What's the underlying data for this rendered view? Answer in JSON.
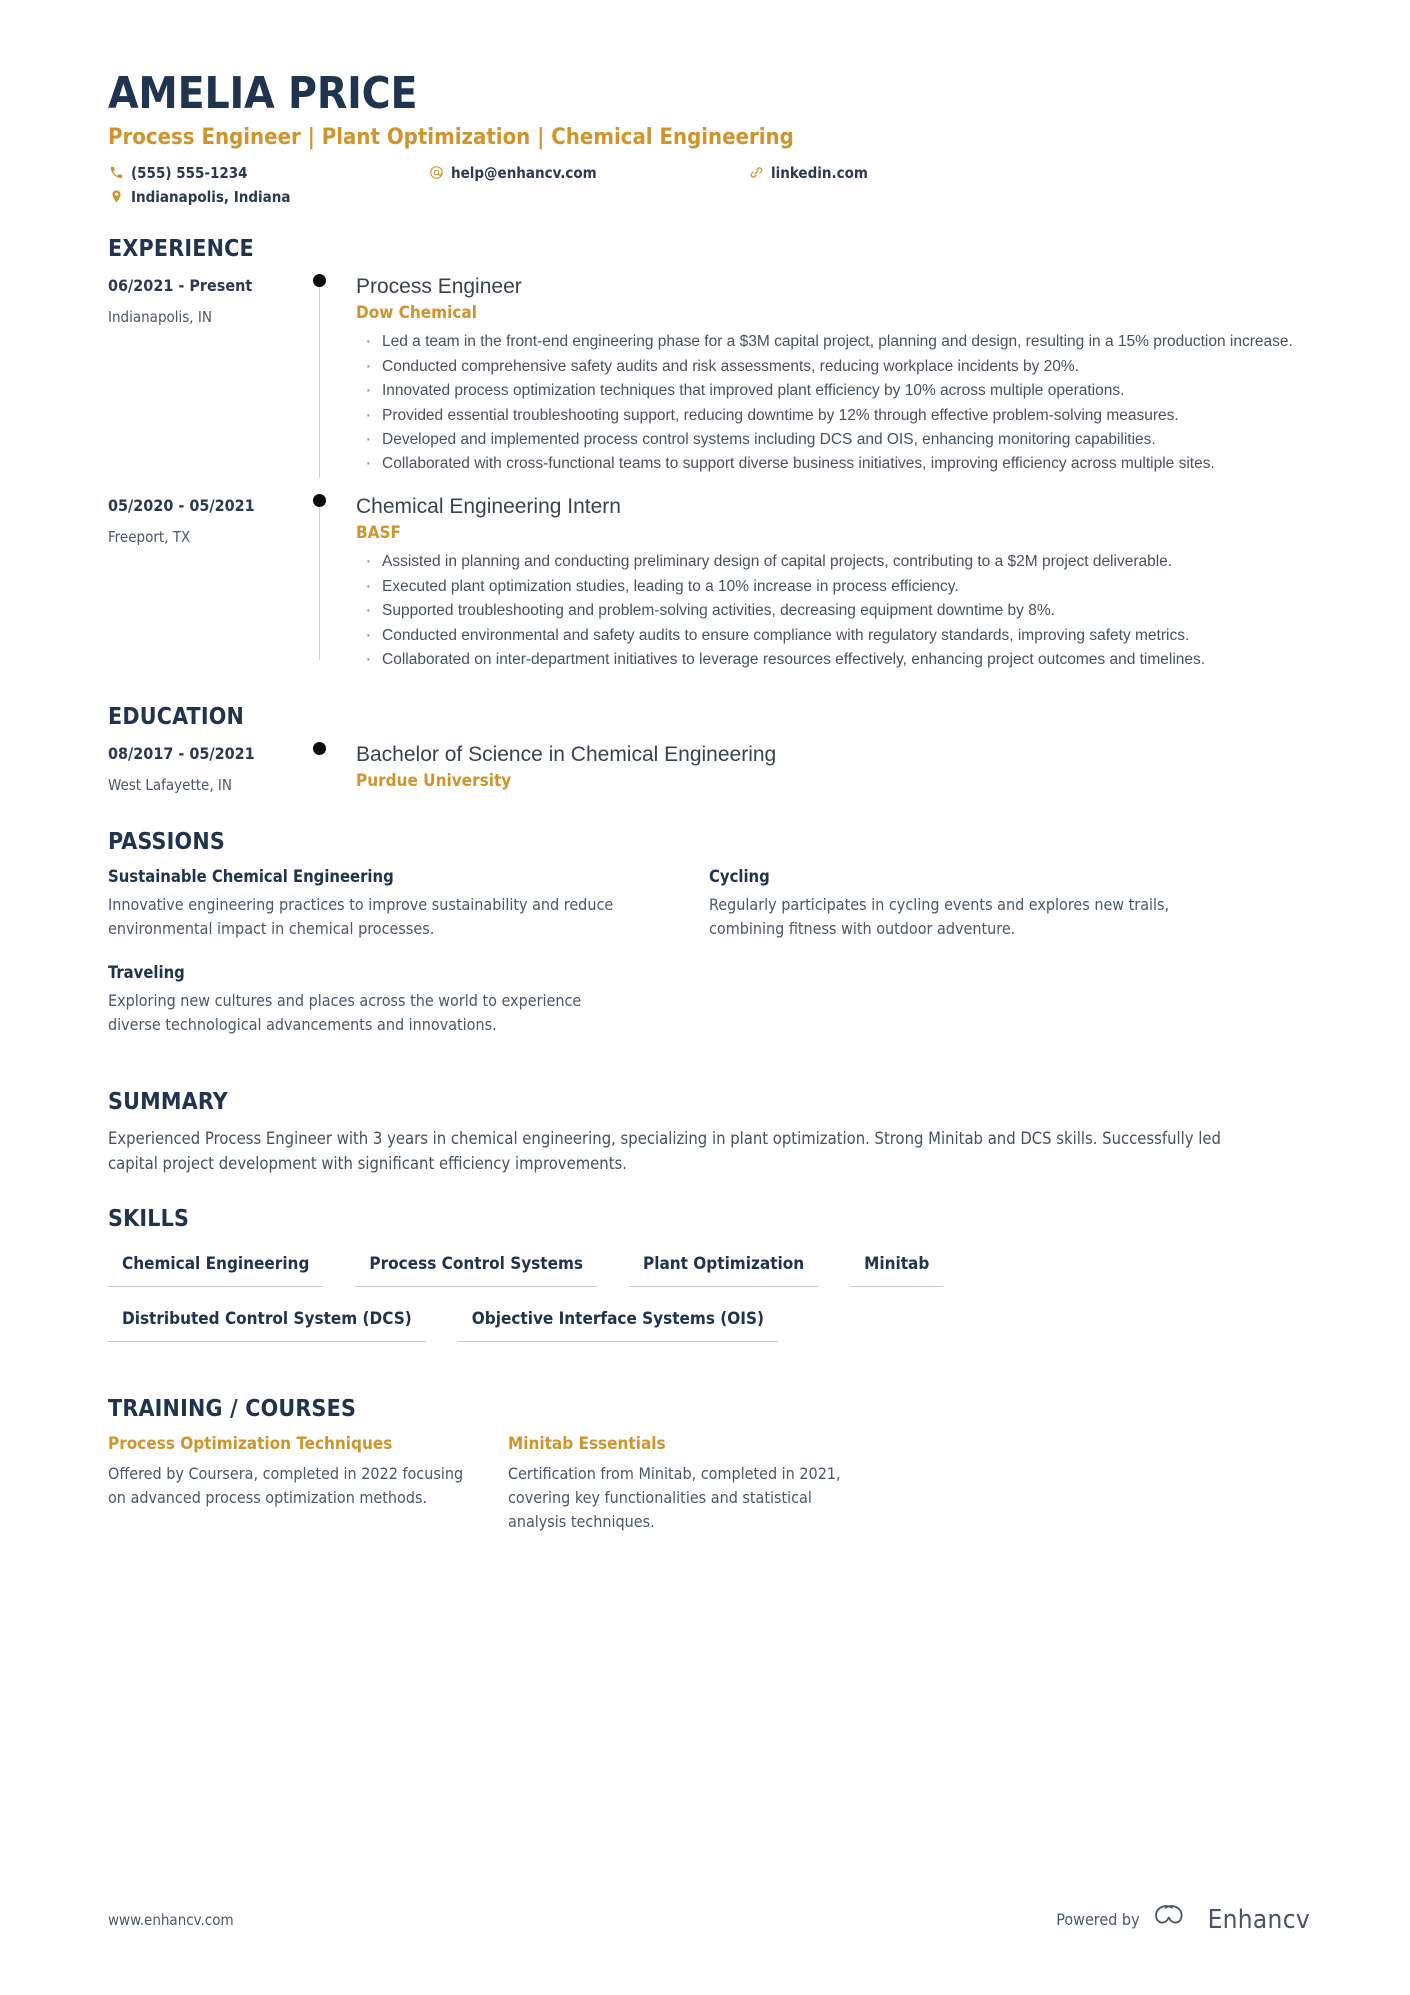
{
  "colors": {
    "navy": "#20344f",
    "gold": "#cf942c",
    "body": "#48515f",
    "rule": "#c7cbd1"
  },
  "header": {
    "name": "AMELIA PRICE",
    "headline": "Process Engineer | Plant Optimization | Chemical Engineering",
    "contacts": [
      {
        "icon": "phone-icon",
        "text": "(555) 555-1234"
      },
      {
        "icon": "email-icon",
        "text": "help@enhancv.com"
      },
      {
        "icon": "link-icon",
        "text": "linkedin.com"
      },
      {
        "icon": "location-icon",
        "text": "Indianapolis, Indiana"
      }
    ]
  },
  "sections": {
    "experience": {
      "title": "EXPERIENCE",
      "entries": [
        {
          "date": "06/2021 - Present",
          "place": "Indianapolis, IN",
          "role": "Process Engineer",
          "org": "Dow Chemical",
          "bullets": [
            "Led a team in the front-end engineering phase for a $3M capital project, planning and design, resulting in a 15% production increase.",
            "Conducted comprehensive safety audits and risk assessments, reducing workplace incidents by 20%.",
            "Innovated process optimization techniques that improved plant efficiency by 10% across multiple operations.",
            "Provided essential troubleshooting support, reducing downtime by 12% through effective problem-solving measures.",
            "Developed and implemented process control systems including DCS and OIS, enhancing monitoring capabilities.",
            "Collaborated with cross-functional teams to support diverse business initiatives, improving efficiency across multiple sites."
          ]
        },
        {
          "date": "05/2020 - 05/2021",
          "place": "Freeport, TX",
          "role": "Chemical Engineering Intern",
          "org": "BASF",
          "bullets": [
            "Assisted in planning and conducting preliminary design of capital projects, contributing to a $2M project deliverable.",
            "Executed plant optimization studies, leading to a 10% increase in process efficiency.",
            "Supported troubleshooting and problem-solving activities, decreasing equipment downtime by 8%.",
            "Conducted environmental and safety audits to ensure compliance with regulatory standards, improving safety metrics.",
            "Collaborated on inter-department initiatives to leverage resources effectively, enhancing project outcomes and timelines."
          ]
        }
      ]
    },
    "education": {
      "title": "EDUCATION",
      "entries": [
        {
          "date": "08/2017 - 05/2021",
          "place": "West Lafayette, IN",
          "degree": "Bachelor of Science in Chemical Engineering",
          "school": "Purdue University"
        }
      ]
    },
    "passions": {
      "title": "PASSIONS",
      "items": [
        {
          "title": "Sustainable Chemical Engineering",
          "text": "Innovative engineering practices to improve sustainability and reduce environmental impact in chemical processes."
        },
        {
          "title": "Cycling",
          "text": "Regularly participates in cycling events and explores new trails, combining fitness with outdoor adventure."
        },
        {
          "title": "Traveling",
          "text": "Exploring new cultures and places across the world to experience diverse technological advancements and innovations."
        }
      ]
    },
    "summary": {
      "title": "SUMMARY",
      "text": "Experienced Process Engineer with 3 years in chemical engineering, specializing in plant optimization. Strong Minitab and DCS skills. Successfully led capital project development with significant efficiency improvements."
    },
    "skills": {
      "title": "SKILLS",
      "items": [
        "Chemical Engineering",
        "Process Control Systems",
        "Plant Optimization",
        "Minitab",
        "Distributed Control System (DCS)",
        "Objective Interface Systems (OIS)"
      ]
    },
    "training": {
      "title": "TRAINING / COURSES",
      "items": [
        {
          "title": "Process Optimization Techniques",
          "text": "Offered by Coursera, completed in 2022 focusing on advanced process optimization methods."
        },
        {
          "title": "Minitab Essentials",
          "text": "Certification from Minitab, completed in 2021, covering key functionalities and statistical analysis techniques."
        }
      ]
    }
  },
  "footer": {
    "url": "www.enhancv.com",
    "powered_by": "Powered by",
    "brand": "Enhancv"
  }
}
